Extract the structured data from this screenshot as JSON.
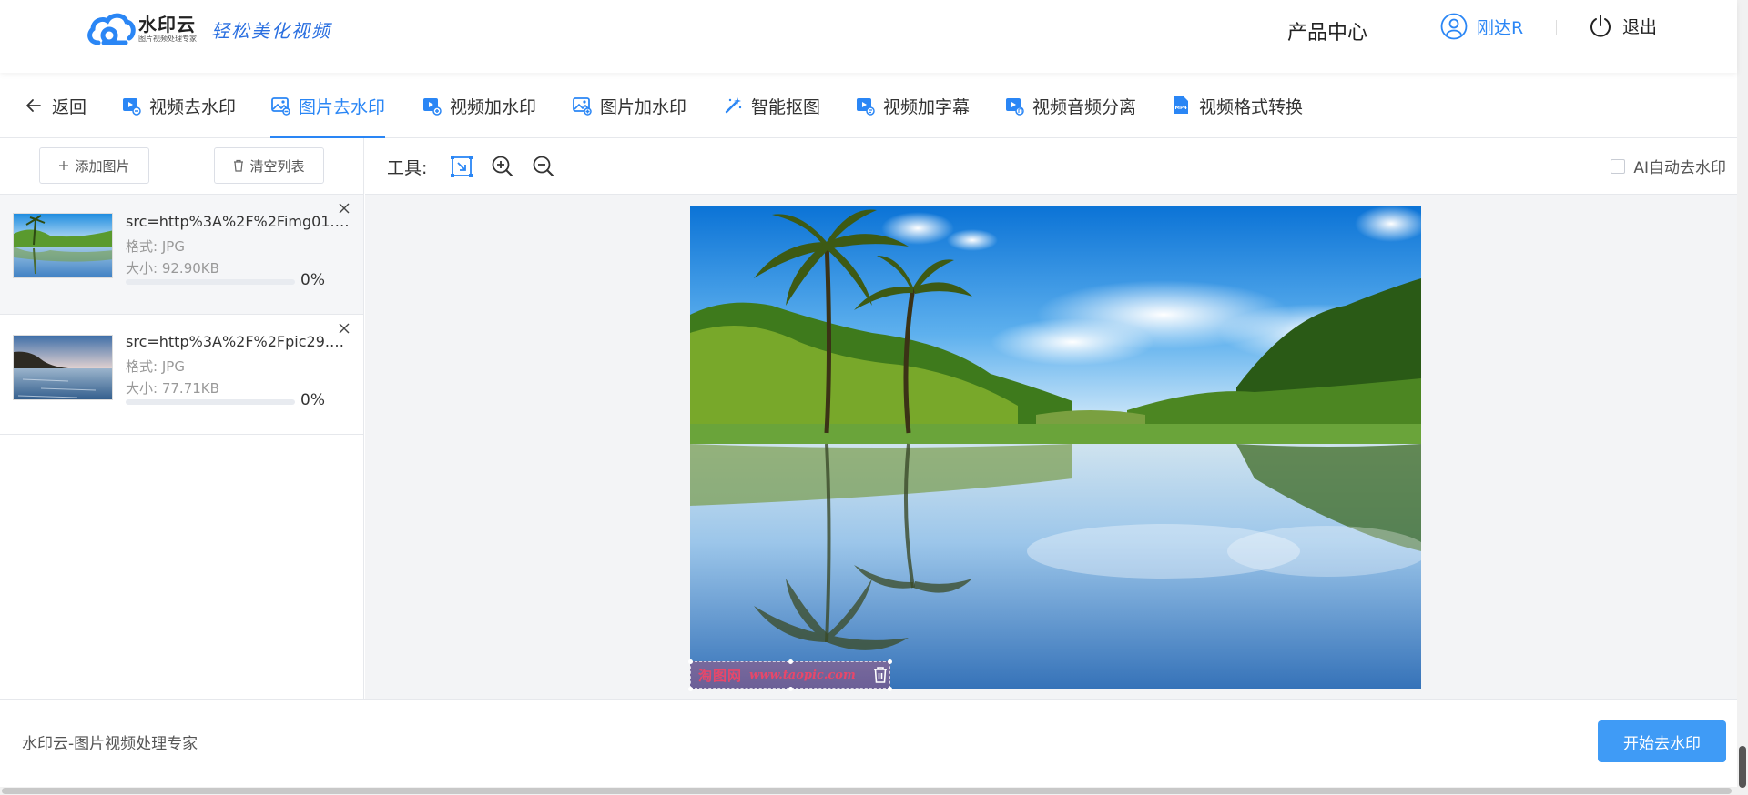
{
  "header": {
    "logo_name": "水印云",
    "logo_sub": "图片视频处理专家",
    "slogan": "轻松美化视频",
    "product_center": "产品中心",
    "username": "刚达R",
    "logout": "退出"
  },
  "nav": {
    "back": "返回",
    "items": [
      {
        "label": "视频去水印",
        "icon": "video-remove-icon"
      },
      {
        "label": "图片去水印",
        "icon": "image-remove-icon",
        "active": true
      },
      {
        "label": "视频加水印",
        "icon": "video-add-icon"
      },
      {
        "label": "图片加水印",
        "icon": "image-add-icon"
      },
      {
        "label": "智能抠图",
        "icon": "magic-wand-icon"
      },
      {
        "label": "视频加字幕",
        "icon": "video-subtitle-icon"
      },
      {
        "label": "视频音频分离",
        "icon": "video-audio-icon"
      },
      {
        "label": "视频格式转换",
        "icon": "mp4-icon"
      }
    ]
  },
  "left": {
    "add_image": "添加图片",
    "clear_list": "清空列表",
    "files": [
      {
        "name": "src=http%3A%2F%2Fimg01.ta...",
        "format_label": "格式:",
        "format": "JPG",
        "size_label": "大小:",
        "size": "92.90KB",
        "progress": 0,
        "progress_text": "0%"
      },
      {
        "name": "src=http%3A%2F%2Fpic29.ni...",
        "format_label": "格式:",
        "format": "JPG",
        "size_label": "大小:",
        "size": "77.71KB",
        "progress": 0,
        "progress_text": "0%"
      }
    ]
  },
  "tools": {
    "label": "工具:",
    "ai_auto": "AI自动去水印"
  },
  "preview": {
    "watermark_text": "淘图网",
    "watermark_url": "www.taopic.com"
  },
  "footer": {
    "text": "水印云-图片视频处理专家",
    "start_button": "开始去水印"
  },
  "colors": {
    "accent": "#2a86f5",
    "primary_button": "#3f9bf6"
  }
}
